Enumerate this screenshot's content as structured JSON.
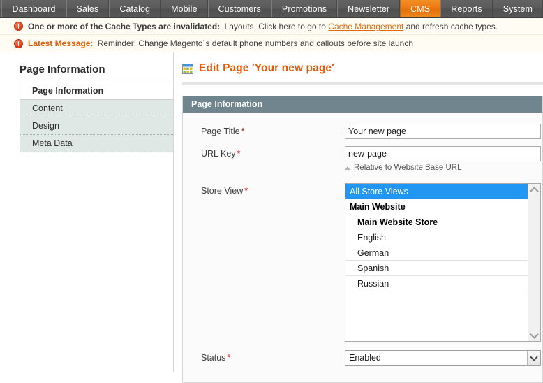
{
  "nav": {
    "items": [
      {
        "label": "Dashboard",
        "active": false
      },
      {
        "label": "Sales",
        "active": false
      },
      {
        "label": "Catalog",
        "active": false
      },
      {
        "label": "Mobile",
        "active": false
      },
      {
        "label": "Customers",
        "active": false
      },
      {
        "label": "Promotions",
        "active": false
      },
      {
        "label": "Newsletter",
        "active": false
      },
      {
        "label": "CMS",
        "active": true
      },
      {
        "label": "Reports",
        "active": false
      },
      {
        "label": "System",
        "active": false
      }
    ],
    "active_color": "#ed7812"
  },
  "messages": [
    {
      "icon": "alert-circle-icon",
      "strong": "One or more of the Cache Types are invalidated:",
      "text_before_link": " Layouts. Click here to go to ",
      "link": "Cache Management",
      "text_after_link": " and refresh cache types."
    },
    {
      "icon": "alert-circle-icon",
      "strong": "Latest Message:",
      "text": " Reminder: Change Magento`s default phone numbers and callouts before site launch"
    }
  ],
  "sidebar": {
    "title": "Page Information",
    "items": [
      {
        "label": "Page Information",
        "active": true
      },
      {
        "label": "Content",
        "active": false
      },
      {
        "label": "Design",
        "active": false
      },
      {
        "label": "Meta Data",
        "active": false
      }
    ]
  },
  "main": {
    "page_title": "Edit Page 'Your new page'",
    "page_icon": "grid-table-icon",
    "panel": {
      "header": "Page Information",
      "fields": {
        "page_title": {
          "label": "Page Title",
          "required": "*",
          "value": "Your new page",
          "placeholder": ""
        },
        "url_key": {
          "label": "URL Key",
          "required": "*",
          "value": "new-page",
          "placeholder": "",
          "hint": "Relative to Website Base URL"
        },
        "store_view": {
          "label": "Store View",
          "required": "*",
          "options": [
            {
              "label": "All Store Views",
              "type": "option",
              "selected": true
            },
            {
              "label": "Main Website",
              "type": "group",
              "selected": false
            },
            {
              "label": "Main Website Store",
              "type": "group2",
              "selected": false
            },
            {
              "label": "English",
              "type": "child",
              "selected": false
            },
            {
              "label": "German",
              "type": "option",
              "selected": false
            },
            {
              "label": "Spanish",
              "type": "option",
              "selected": false
            },
            {
              "label": "Russian",
              "type": "option",
              "selected": false
            }
          ]
        },
        "status": {
          "label": "Status",
          "required": "*",
          "value": "Enabled"
        }
      }
    }
  }
}
